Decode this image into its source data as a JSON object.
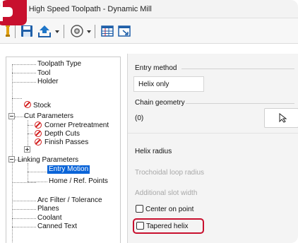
{
  "window": {
    "title": ") High Speed Toolpath - Dynamic Mill"
  },
  "toolbar": {
    "icons": [
      "pin-icon",
      "save-icon",
      "import-icon",
      "dropdown-arrow-icon",
      "view-icon",
      "dropdown-arrow-icon",
      "grid-icon",
      "window-icon"
    ]
  },
  "tree": {
    "items": [
      {
        "label": "Toolpath Type",
        "error": false
      },
      {
        "label": "Tool",
        "error": false
      },
      {
        "label": "Holder",
        "error": false
      },
      {
        "label": "Stock",
        "error": true
      },
      {
        "label": "Cut Parameters",
        "error": false
      },
      {
        "label": "Corner Pretreatment",
        "error": true
      },
      {
        "label": "Depth Cuts",
        "error": true
      },
      {
        "label": "Finish Passes",
        "error": true
      },
      {
        "label": "Linking Parameters",
        "error": false
      },
      {
        "label": "Entry Motion",
        "error": false,
        "selected": true
      },
      {
        "label": "Home / Ref. Points",
        "error": false
      },
      {
        "label": "Arc Filter / Tolerance",
        "error": false
      },
      {
        "label": "Planes",
        "error": false
      },
      {
        "label": "Coolant",
        "error": false
      },
      {
        "label": "Canned Text",
        "error": false
      }
    ]
  },
  "entry": {
    "method_label": "Entry method",
    "method_value": "Helix only",
    "chain_label": "Chain geometry",
    "chain_value": "(0)",
    "helix_radius_label": "Helix radius",
    "trochoidal_label": "Trochoidal loop radius",
    "slot_width_label": "Additional slot width",
    "center_on_point_label": "Center on point",
    "tapered_helix_label": "Tapered helix",
    "center_on_point_checked": false,
    "tapered_helix_checked": false
  },
  "colors": {
    "accent_red": "#c8102e",
    "selection_blue": "#0a64d8",
    "error_red": "#d21b1b",
    "save_blue": "#1f5fa8"
  }
}
